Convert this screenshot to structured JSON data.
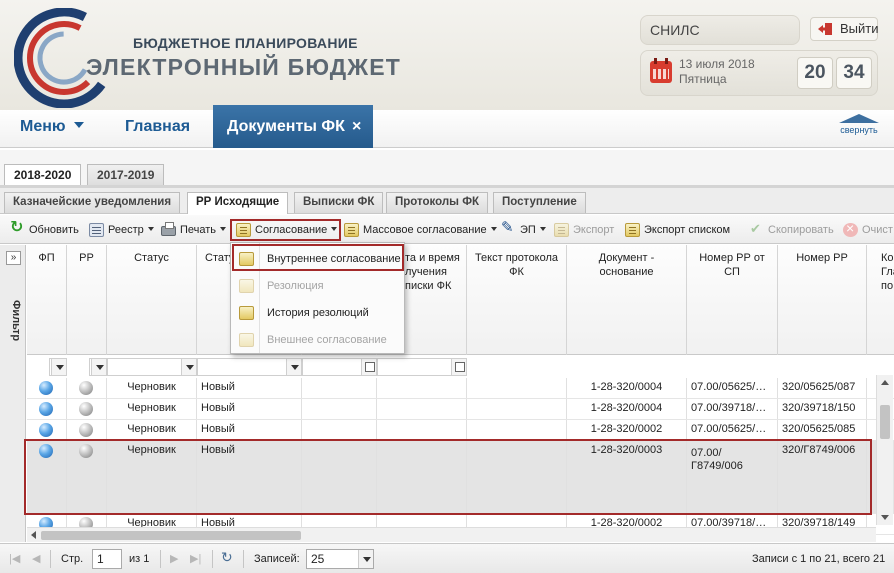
{
  "header": {
    "brand_line1": "БЮДЖЕТНОЕ ПЛАНИРОВАНИЕ",
    "brand_line2": "ЭЛЕКТРОННЫЙ БЮДЖЕТ",
    "snils_placeholder": "СНИЛС",
    "exit_label": "Выйти",
    "date_line1": "13 июля 2018",
    "date_line2": "Пятница",
    "clock_hours": "20",
    "clock_minutes": "34"
  },
  "nav": {
    "menu_label": "Меню",
    "home_label": "Главная",
    "active_tab": "Документы ФК",
    "active_tab_close": "×",
    "collapse_label": "свернуть"
  },
  "year_tabs": [
    "2018-2020",
    "2017-2019"
  ],
  "sub_tabs": [
    "Казначейские уведомления",
    "РР Исходящие",
    "Выписки ФК",
    "Протоколы ФК",
    "Поступление"
  ],
  "toolbar": {
    "refresh": "Обновить",
    "reestr": "Реестр",
    "print": "Печать",
    "approval": "Согласование",
    "mass_approval": "Массовое согласование",
    "ep": "ЭП",
    "export": "Экспорт",
    "export_list": "Экспорт списком",
    "copy": "Скопировать",
    "clear": "Очист"
  },
  "filter_tab": {
    "toggle": "»",
    "label": "Фильтр"
  },
  "approval_menu": {
    "items": [
      {
        "label": "Внутреннее согласование",
        "enabled": true
      },
      {
        "label": "Резолюция",
        "enabled": false
      },
      {
        "label": "История резолюций",
        "enabled": true
      },
      {
        "label": "Внешнее согласование",
        "enabled": false
      }
    ]
  },
  "grid": {
    "columns": [
      "ФП",
      "РР",
      "Статус",
      "Стату",
      "",
      "та и время\nлучения\nписки ФК",
      "Текст протокола\nФК",
      "Документ -\nоснование",
      "Номер РР от\nСП",
      "Номер РР",
      "Ко\nГла\nпо Б"
    ],
    "rows": [
      {
        "fp": "blue",
        "rr": "gray",
        "status": "Черновик",
        "status2": "Новый",
        "doc": "1-28-320/0004",
        "num_sp": "07.00/05625/…",
        "num_rr": "320/05625/087"
      },
      {
        "fp": "blue",
        "rr": "gray",
        "status": "Черновик",
        "status2": "Новый",
        "doc": "1-28-320/0004",
        "num_sp": "07.00/39718/…",
        "num_rr": "320/39718/150"
      },
      {
        "fp": "blue",
        "rr": "gray",
        "status": "Черновик",
        "status2": "Новый",
        "doc": "1-28-320/0002",
        "num_sp": "07.00/05625/…",
        "num_rr": "320/05625/085"
      },
      {
        "fp": "blue",
        "rr": "gray",
        "status": "Черновик",
        "status2": "Новый",
        "doc": "1-28-320/0003",
        "num_sp": "07.00/\nГ8749/006",
        "num_rr": "320/Г8749/006"
      },
      {
        "fp": "blue",
        "rr": "gray",
        "status": "Черновик",
        "status2": "Новый",
        "doc": "1-28-320/0002",
        "num_sp": "07.00/39718/…",
        "num_rr": "320/39718/149"
      }
    ]
  },
  "pager": {
    "page_label": "Стр.",
    "page_value": "1",
    "of_label": "из 1",
    "records_label": "Записей:",
    "records_value": "25",
    "summary": "Записи с 1 по 21, всего 21"
  },
  "colors": {
    "accent": "#255a8c",
    "highlight_frame": "#a32a2a",
    "link": "#1d5b94"
  }
}
